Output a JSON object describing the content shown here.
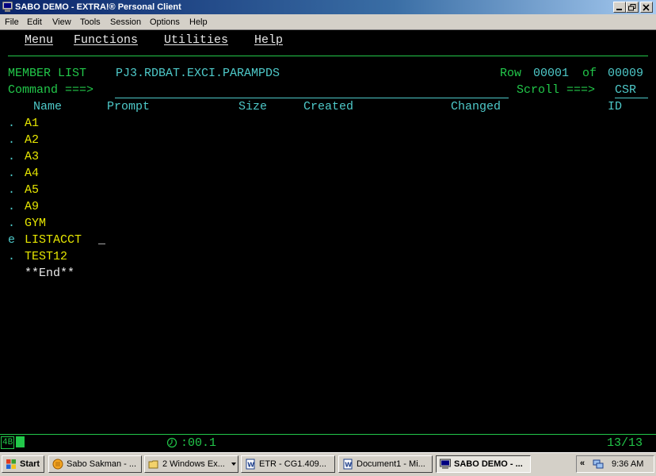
{
  "window": {
    "title": "SABO DEMO - EXTRA!® Personal Client",
    "menu": [
      "File",
      "Edit",
      "View",
      "Tools",
      "Session",
      "Options",
      "Help"
    ]
  },
  "terminal": {
    "actions": [
      "Menu",
      "Functions",
      "Utilities",
      "Help"
    ],
    "panel_title": "MEMBER LIST",
    "dataset": "PJ3.RDBAT.EXCI.PARAMPDS",
    "row_label": "Row",
    "row_current": "00001",
    "row_of": "of",
    "row_total": "00009",
    "command_label": "Command ===>",
    "command_value": "",
    "scroll_label": "Scroll ===>",
    "scroll_value": "CSR",
    "columns": [
      "Name",
      "Prompt",
      "Size",
      "Created",
      "Changed",
      "ID"
    ],
    "members": [
      {
        "cmd": ".",
        "name": "A1"
      },
      {
        "cmd": ".",
        "name": "A2"
      },
      {
        "cmd": ".",
        "name": "A3"
      },
      {
        "cmd": ".",
        "name": "A4"
      },
      {
        "cmd": ".",
        "name": "A5"
      },
      {
        "cmd": ".",
        "name": "A9"
      },
      {
        "cmd": ".",
        "name": "GYM"
      },
      {
        "cmd": "e",
        "name": "LISTACCT"
      },
      {
        "cmd": ".",
        "name": "TEST12"
      }
    ],
    "end_marker": "**End**"
  },
  "oia": {
    "session_box": "4B",
    "timer": ":00.1",
    "cursor_pos": "13/13"
  },
  "taskbar": {
    "start_label": "Start",
    "buttons": [
      {
        "label": "Sabo Sakman - ..."
      },
      {
        "label": "2 Windows Ex..."
      },
      {
        "label": "ETR - CG1.409..."
      },
      {
        "label": "Document1 - Mi..."
      },
      {
        "label": "SABO DEMO - ..."
      }
    ],
    "tray_chevron": "«",
    "clock": "9:36 AM"
  },
  "colors": {
    "green": "#22c84a",
    "cyan": "#4ec9c9",
    "yellow": "#e6e600",
    "white": "#e8e8e8"
  }
}
